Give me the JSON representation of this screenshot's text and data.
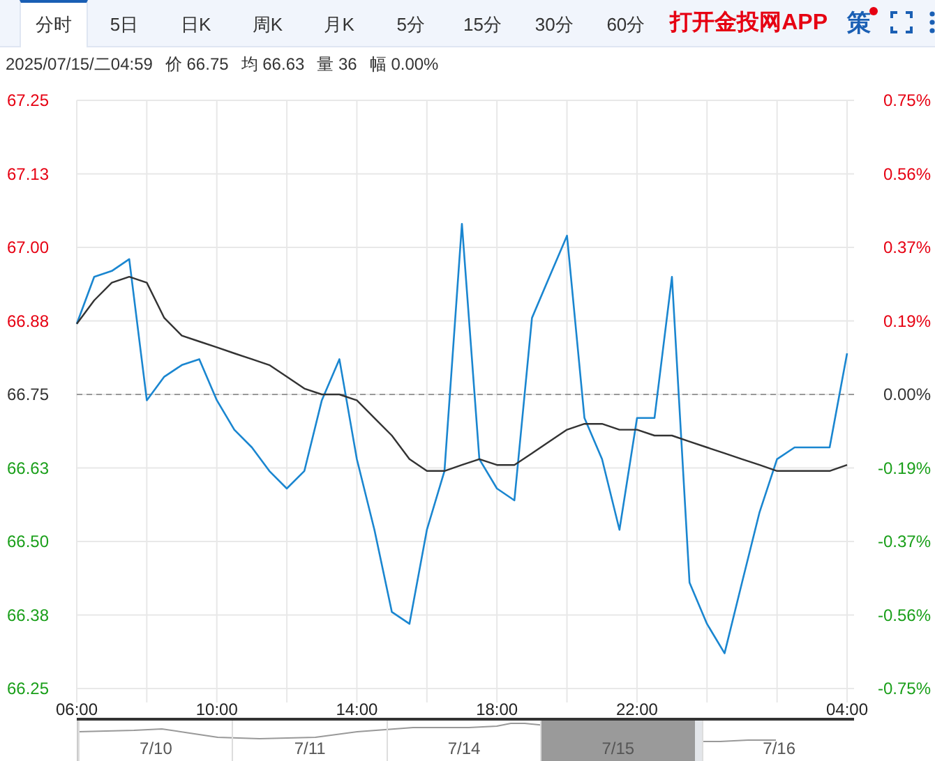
{
  "tabs": [
    {
      "label": "分时",
      "selected": true
    },
    {
      "label": "5日",
      "selected": false
    },
    {
      "label": "日K",
      "selected": false
    },
    {
      "label": "周K",
      "selected": false
    },
    {
      "label": "月K",
      "selected": false
    },
    {
      "label": "5分",
      "selected": false
    },
    {
      "label": "15分",
      "selected": false
    },
    {
      "label": "30分",
      "selected": false
    },
    {
      "label": "60分",
      "selected": false
    }
  ],
  "promo": "打开金投网APP",
  "strategy_button": {
    "label": "策",
    "badge": true
  },
  "info": {
    "datetime": "2025/07/15/二04:59",
    "fields": [
      {
        "label": "价",
        "value": "66.75"
      },
      {
        "label": "均",
        "value": "66.63"
      },
      {
        "label": "量",
        "value": "36"
      },
      {
        "label": "幅",
        "value": "0.00%"
      }
    ]
  },
  "chart": {
    "percent_ticks": [
      "0.75%",
      "0.56%",
      "0.37%",
      "0.19%",
      "0.00%",
      "-0.19%",
      "-0.37%",
      "-0.56%",
      "-0.75%"
    ],
    "chart_data": {
      "type": "line",
      "ylim": [
        66.25,
        67.25
      ],
      "yticks": [
        {
          "value": 67.25,
          "label": "67.25"
        },
        {
          "value": 67.125,
          "label": "67.13"
        },
        {
          "value": 67.0,
          "label": "67.00"
        },
        {
          "value": 66.875,
          "label": "66.88"
        },
        {
          "value": 66.75,
          "label": "66.75"
        },
        {
          "value": 66.625,
          "label": "66.63"
        },
        {
          "value": 66.5,
          "label": "66.50"
        },
        {
          "value": 66.375,
          "label": "66.38"
        },
        {
          "value": 66.25,
          "label": "66.25"
        }
      ],
      "categories": [
        "06:00",
        null,
        null,
        null,
        null,
        null,
        null,
        null,
        "10:00",
        null,
        null,
        null,
        null,
        null,
        null,
        null,
        "14:00",
        null,
        null,
        null,
        null,
        null,
        null,
        null,
        "18:00",
        null,
        null,
        null,
        null,
        null,
        null,
        null,
        "22:00",
        null,
        null,
        null,
        null,
        null,
        null,
        null,
        null,
        null,
        null,
        null,
        "04:00"
      ],
      "series": [
        {
          "color": "#1a86d0",
          "values": [
            66.87,
            66.95,
            66.96,
            66.98,
            66.74,
            66.78,
            66.8,
            66.81,
            66.74,
            66.69,
            66.66,
            66.62,
            66.59,
            66.62,
            66.74,
            66.81,
            66.64,
            66.52,
            66.38,
            66.36,
            66.52,
            66.62,
            67.04,
            66.64,
            66.59,
            66.57,
            66.88,
            66.95,
            67.02,
            66.71,
            66.64,
            66.52,
            66.71,
            66.71,
            66.95,
            66.43,
            66.36,
            66.31,
            66.43,
            66.55,
            66.64,
            66.66,
            66.66,
            66.66,
            66.82
          ]
        },
        {
          "color": "#333333",
          "values": [
            66.87,
            66.91,
            66.94,
            66.95,
            66.94,
            66.88,
            66.85,
            66.84,
            66.83,
            66.82,
            66.81,
            66.8,
            66.78,
            66.76,
            66.75,
            66.75,
            66.74,
            66.71,
            66.68,
            66.64,
            66.62,
            66.62,
            66.63,
            66.64,
            66.63,
            66.63,
            66.65,
            66.67,
            66.69,
            66.7,
            66.7,
            66.69,
            66.69,
            66.68,
            66.68,
            66.67,
            66.66,
            66.65,
            66.64,
            66.63,
            66.62,
            66.62,
            66.62,
            66.62,
            66.63
          ]
        }
      ],
      "grid": true,
      "ref_lines": [
        {
          "axis": "y",
          "value": 66.75
        }
      ]
    }
  },
  "navigator": {
    "dates": [
      {
        "label": "7/10",
        "selected": false
      },
      {
        "label": "7/11",
        "selected": false
      },
      {
        "label": "7/14",
        "selected": false
      },
      {
        "label": "7/15",
        "selected": true
      },
      {
        "label": "7/16",
        "selected": false
      }
    ]
  }
}
